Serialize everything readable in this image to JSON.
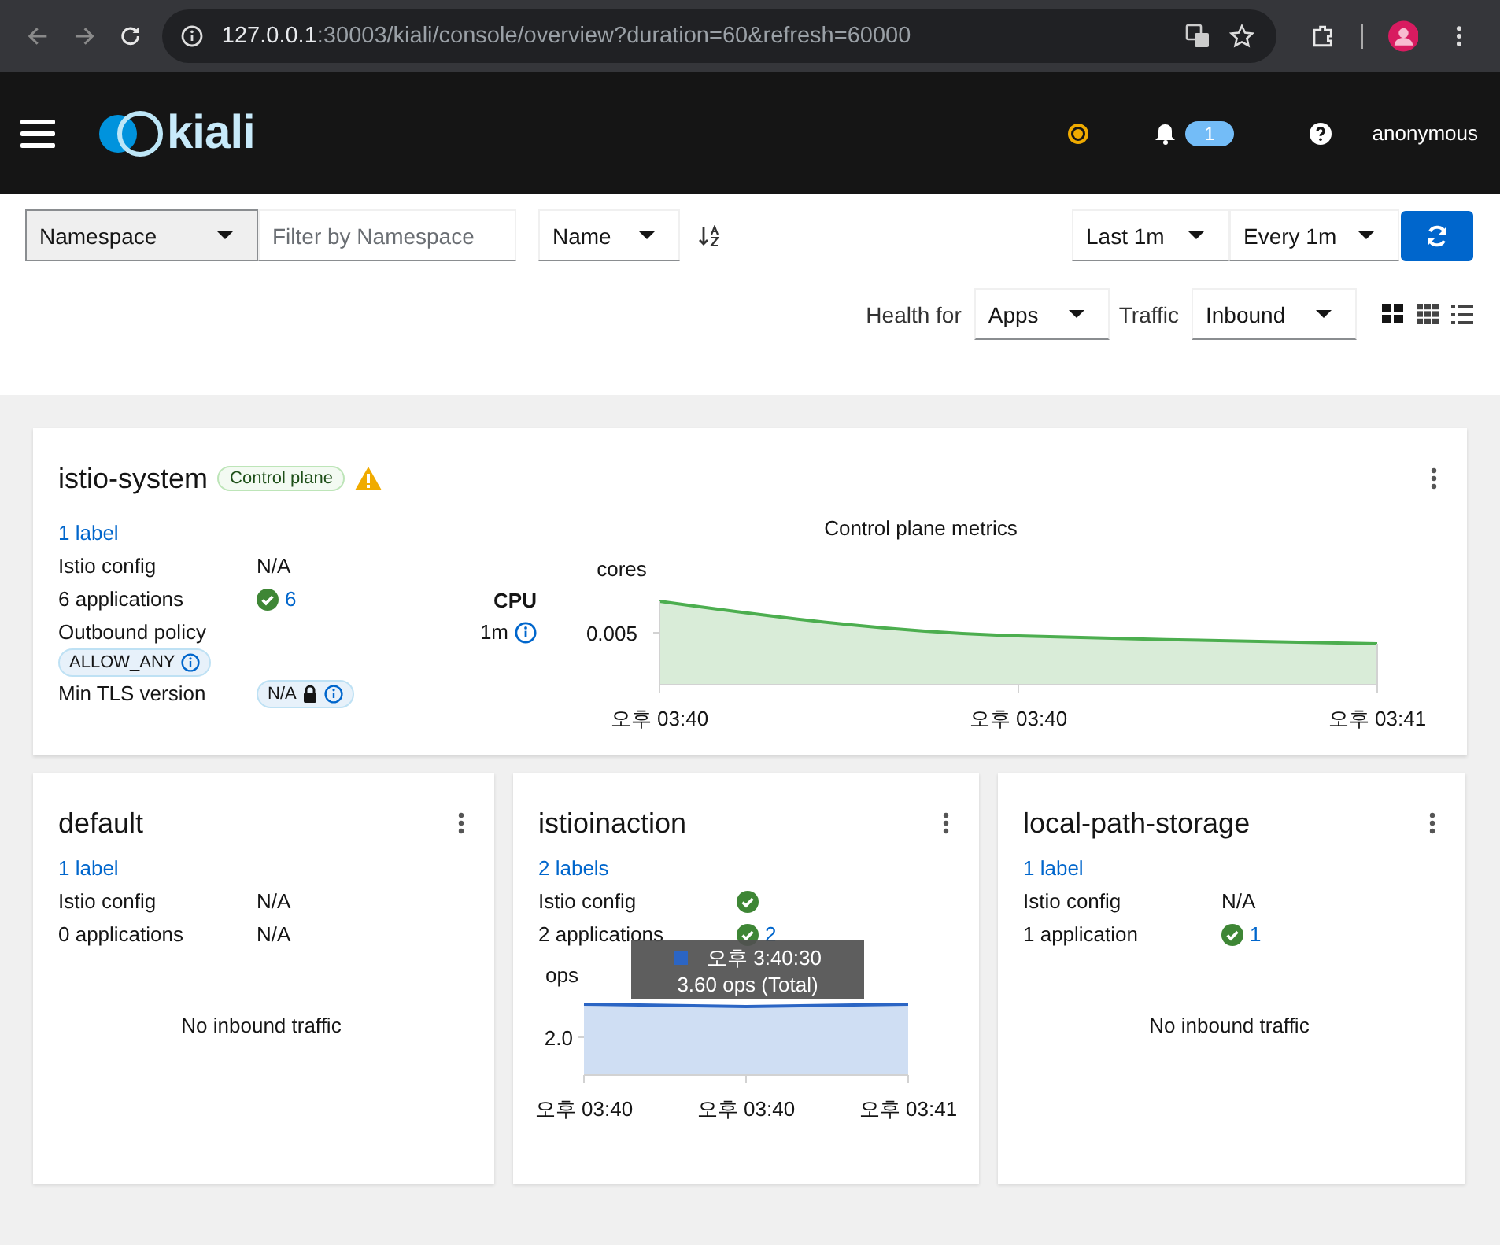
{
  "browser": {
    "url_host": "127.0.0.1",
    "url_rest": ":30003/kiali/console/overview?duration=60&refresh=60000"
  },
  "header": {
    "logo_text": "kiali",
    "notifications": "1",
    "user": "anonymous"
  },
  "toolbar": {
    "filter_type": "Namespace",
    "filter_placeholder": "Filter by Namespace",
    "sort": "Name",
    "duration": "Last 1m",
    "refresh": "Every 1m",
    "health_label": "Health for",
    "health": "Apps",
    "traffic_label": "Traffic",
    "traffic": "Inbound"
  },
  "namespaces": [
    {
      "name": "istio-system",
      "badge": "Control plane",
      "warning": true,
      "labels": "1 label",
      "rows": [
        {
          "kind": "text",
          "label": "Istio config",
          "value": "N/A"
        },
        {
          "kind": "health",
          "label": "6 applications",
          "value": "6"
        },
        {
          "kind": "chip",
          "label": "Outbound policy",
          "value": "ALLOW_ANY"
        },
        {
          "kind": "tls",
          "label": "Min TLS version",
          "value": "N/A"
        }
      ],
      "metrics": {
        "title": "Control plane metrics",
        "name": "CPU",
        "interval": "1m",
        "unit": "cores",
        "ytick": "0.005",
        "xlabels": [
          "오후 03:40",
          "오후 03:40",
          "오후 03:41"
        ]
      }
    },
    {
      "name": "default",
      "labels": "1 label",
      "rows": [
        {
          "kind": "text",
          "label": "Istio config",
          "value": "N/A"
        },
        {
          "kind": "text",
          "label": "0 applications",
          "value": "N/A"
        }
      ],
      "traffic": {
        "kind": "none",
        "message": "No inbound traffic"
      }
    },
    {
      "name": "istioinaction",
      "labels": "2 labels",
      "rows": [
        {
          "kind": "ok",
          "label": "Istio config"
        },
        {
          "kind": "health",
          "label": "2 applications",
          "value": "2"
        }
      ],
      "traffic": {
        "kind": "chart",
        "unit": "ops",
        "ytick": "2.0",
        "xlabels": [
          "오후 03:40",
          "오후 03:40",
          "오후 03:41"
        ],
        "tooltip": {
          "time": "오후 3:40:30",
          "value": "3.60 ops (Total)"
        }
      }
    },
    {
      "name": "local-path-storage",
      "labels": "1 label",
      "rows": [
        {
          "kind": "text",
          "label": "Istio config",
          "value": "N/A"
        },
        {
          "kind": "health",
          "label": "1 application",
          "value": "1"
        }
      ],
      "traffic": {
        "kind": "none",
        "message": "No inbound traffic"
      }
    }
  ]
}
